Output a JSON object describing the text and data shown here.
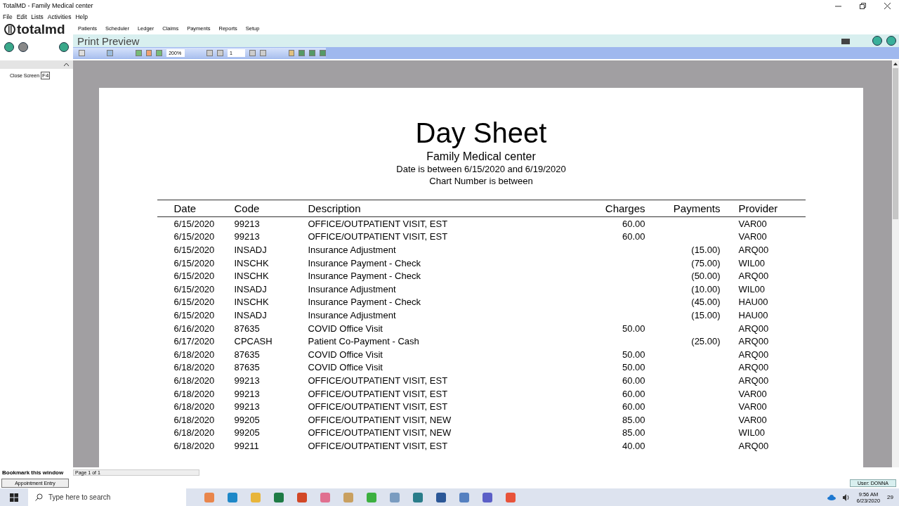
{
  "window": {
    "title": "TotalMD - Family Medical center"
  },
  "menu": [
    "File",
    "Edit",
    "Lists",
    "Activities",
    "Help"
  ],
  "logo": "totalmd",
  "nav_menu": [
    "Patients",
    "Scheduler",
    "Ledger",
    "Claims",
    "Payments",
    "Reports",
    "Setup"
  ],
  "screen_title": "Print Preview",
  "toolbar": {
    "zoom": "200%",
    "page": "1"
  },
  "sidebar": {
    "items": [
      {
        "label": "Close Screen",
        "key": "F4"
      }
    ]
  },
  "report": {
    "title": "Day Sheet",
    "subtitles": [
      "Family Medical center",
      "Date is between 6/15/2020 and 6/19/2020",
      "Chart Number is between"
    ],
    "columns": [
      "Date",
      "Code",
      "Description",
      "Charges",
      "Payments",
      "Provider"
    ],
    "rows": [
      [
        "6/15/2020",
        "99213",
        "OFFICE/OUTPATIENT VISIT, EST",
        "60.00",
        "",
        "VAR00"
      ],
      [
        "6/15/2020",
        "99213",
        "OFFICE/OUTPATIENT VISIT, EST",
        "60.00",
        "",
        "VAR00"
      ],
      [
        "6/15/2020",
        "INSADJ",
        "Insurance Adjustment",
        "",
        "(15.00)",
        "ARQ00"
      ],
      [
        "6/15/2020",
        "INSCHK",
        "Insurance Payment - Check",
        "",
        "(75.00)",
        "WIL00"
      ],
      [
        "6/15/2020",
        "INSCHK",
        "Insurance Payment - Check",
        "",
        "(50.00)",
        "ARQ00"
      ],
      [
        "6/15/2020",
        "INSADJ",
        "Insurance Adjustment",
        "",
        "(10.00)",
        "WIL00"
      ],
      [
        "6/15/2020",
        "INSCHK",
        "Insurance Payment - Check",
        "",
        "(45.00)",
        "HAU00"
      ],
      [
        "6/15/2020",
        "INSADJ",
        "Insurance Adjustment",
        "",
        "(15.00)",
        "HAU00"
      ],
      [
        "6/16/2020",
        "87635",
        "COVID Office Visit",
        "50.00",
        "",
        "ARQ00"
      ],
      [
        "6/17/2020",
        "CPCASH",
        "Patient Co-Payment - Cash",
        "",
        "(25.00)",
        "ARQ00"
      ],
      [
        "6/18/2020",
        "87635",
        "COVID Office Visit",
        "50.00",
        "",
        "ARQ00"
      ],
      [
        "6/18/2020",
        "87635",
        "COVID Office Visit",
        "50.00",
        "",
        "ARQ00"
      ],
      [
        "6/18/2020",
        "99213",
        "OFFICE/OUTPATIENT VISIT, EST",
        "60.00",
        "",
        "ARQ00"
      ],
      [
        "6/18/2020",
        "99213",
        "OFFICE/OUTPATIENT VISIT, EST",
        "60.00",
        "",
        "VAR00"
      ],
      [
        "6/18/2020",
        "99213",
        "OFFICE/OUTPATIENT VISIT, EST",
        "60.00",
        "",
        "VAR00"
      ],
      [
        "6/18/2020",
        "99205",
        "OFFICE/OUTPATIENT VISIT, NEW",
        "85.00",
        "",
        "VAR00"
      ],
      [
        "6/18/2020",
        "99205",
        "OFFICE/OUTPATIENT VISIT, NEW",
        "85.00",
        "",
        "WIL00"
      ],
      [
        "6/18/2020",
        "99211",
        "OFFICE/OUTPATIENT VISIT, EST",
        "40.00",
        "",
        "ARQ00"
      ]
    ]
  },
  "bookmark": "Bookmark this window",
  "status": "Page 1 of 1",
  "bookmarks": [
    "Appointment Entry"
  ],
  "user": "User: DONNA",
  "taskbar": {
    "search_placeholder": "Type here to search",
    "time": "9:56 AM",
    "date": "6/23/2020",
    "notifications": "29"
  }
}
